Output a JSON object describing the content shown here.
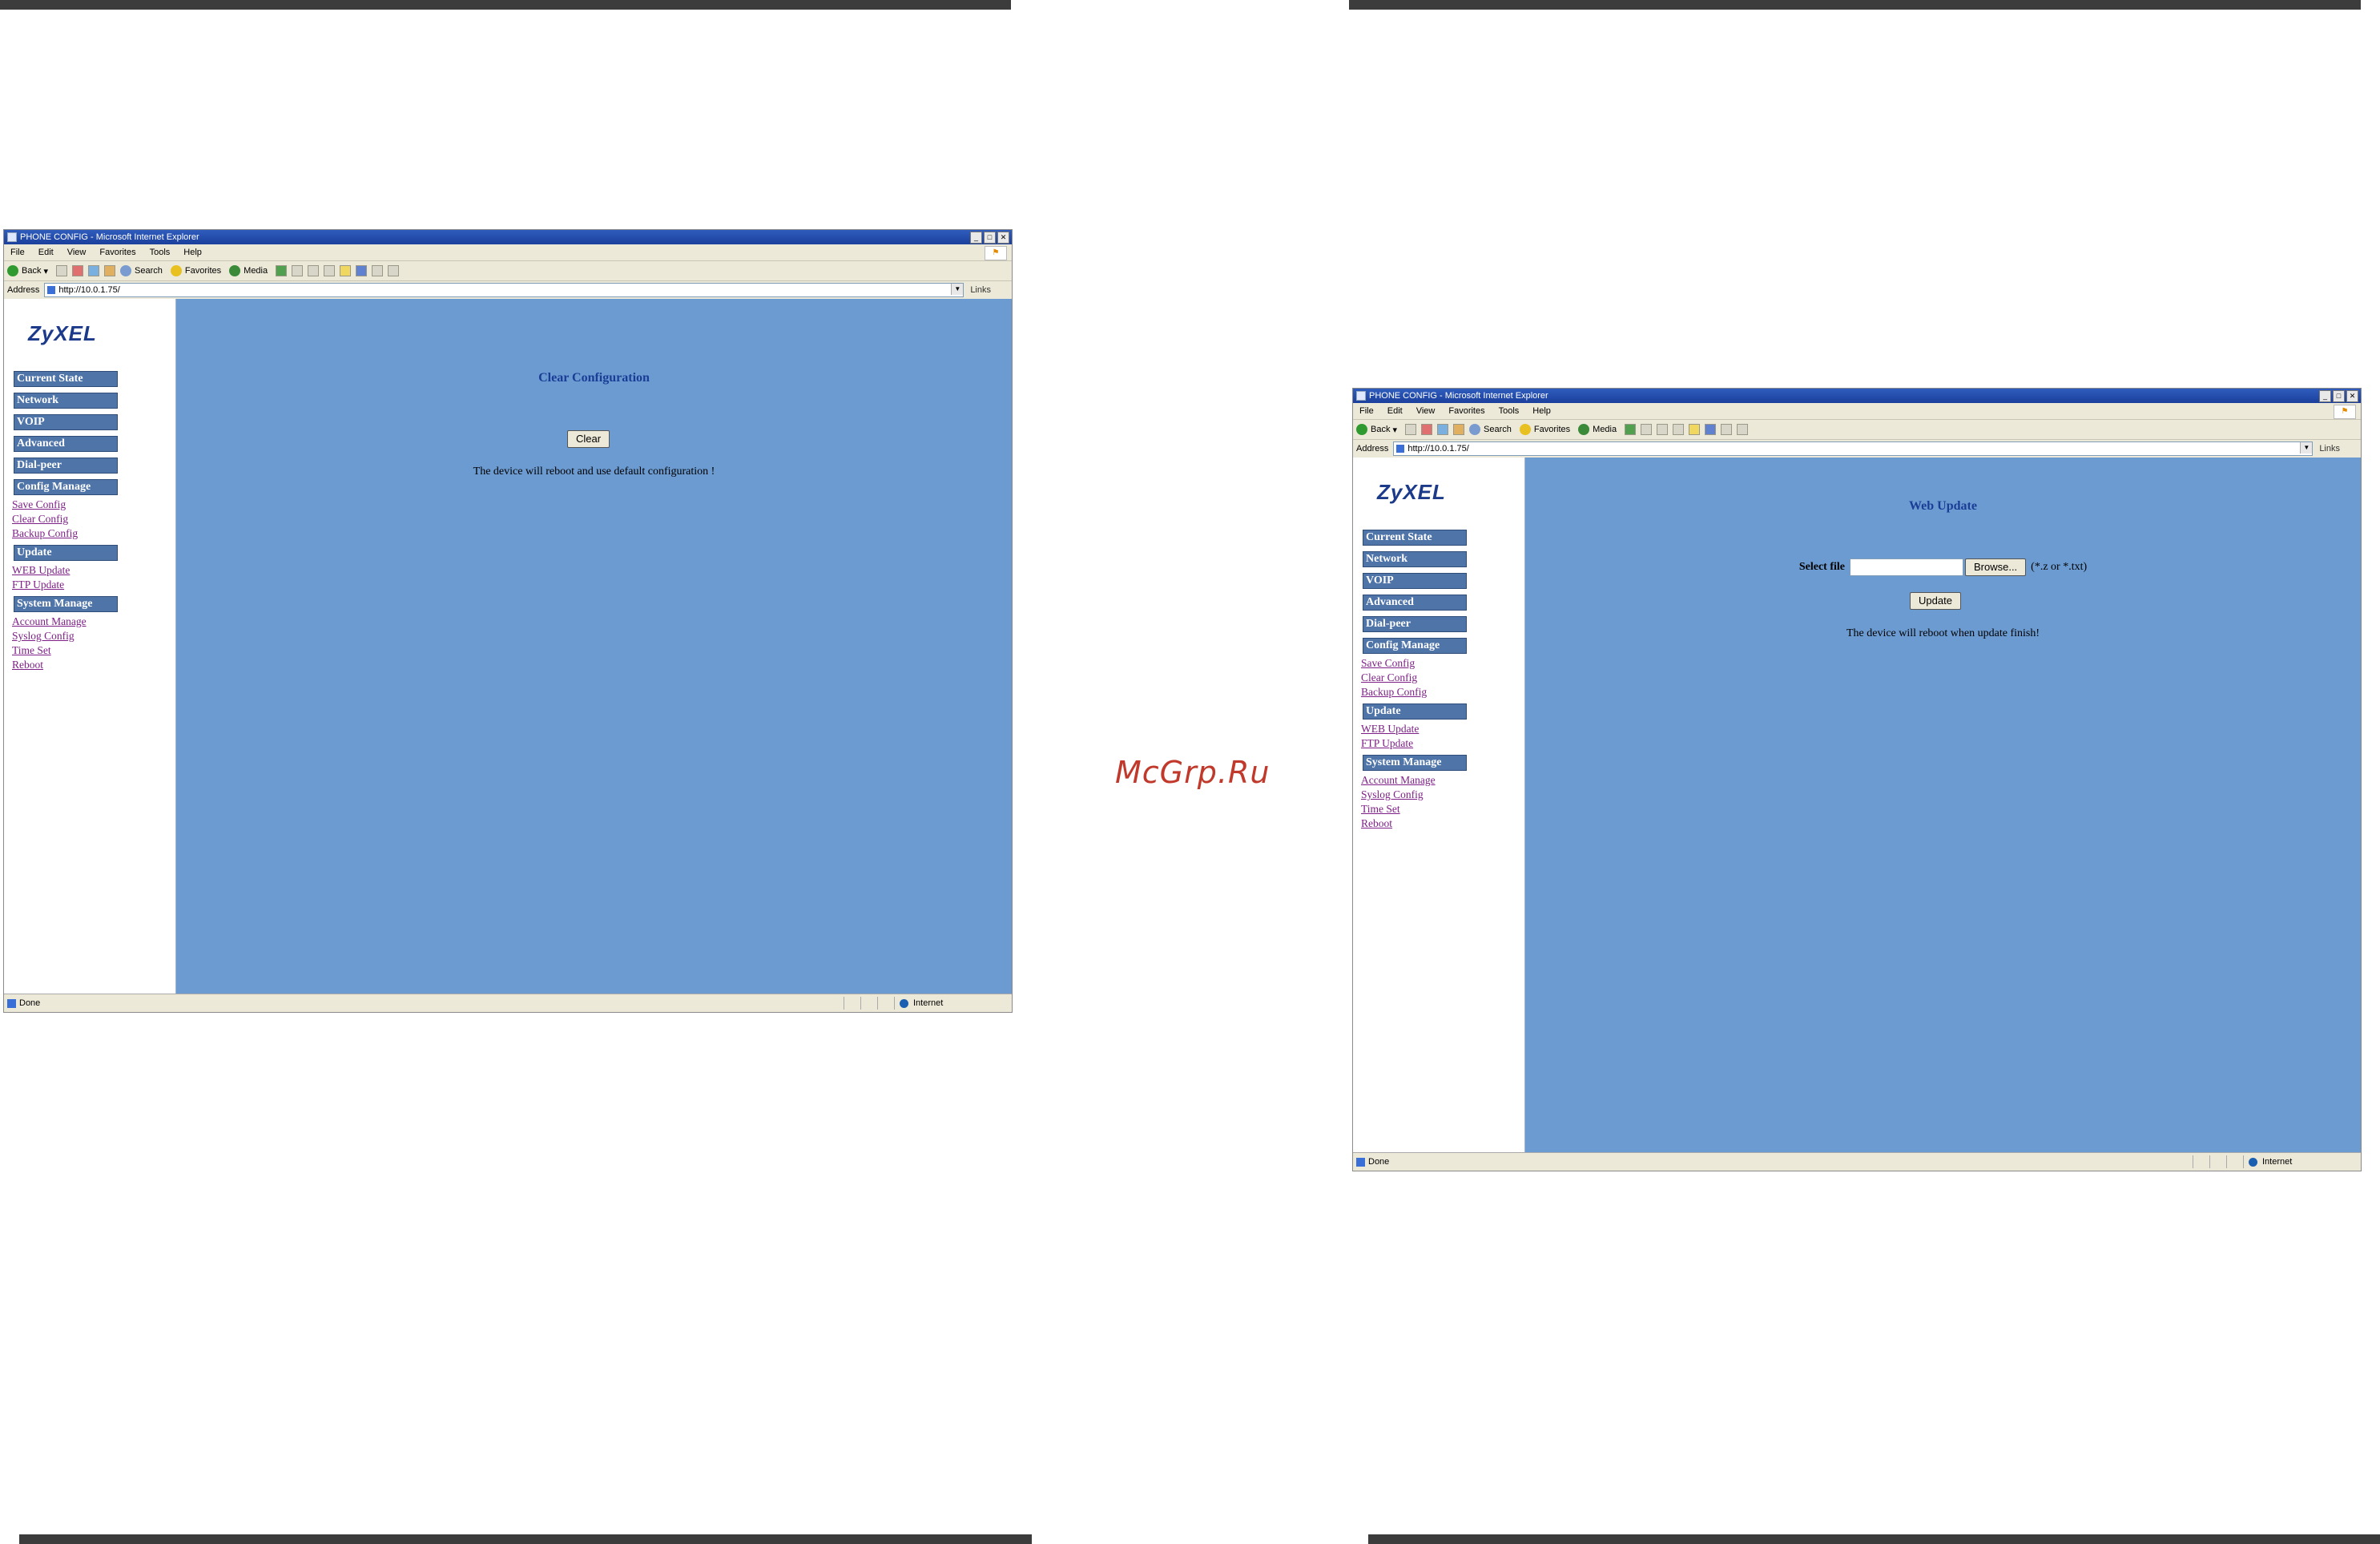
{
  "watermark": "McGrp.Ru",
  "windows": [
    {
      "title": "PHONE CONFIG - Microsoft Internet Explorer",
      "menu": [
        "File",
        "Edit",
        "View",
        "Favorites",
        "Tools",
        "Help"
      ],
      "toolbar": {
        "back": "Back",
        "search": "Search",
        "favorites": "Favorites",
        "media": "Media"
      },
      "address_label": "Address",
      "address_url": "http://10.0.1.75/",
      "links_label": "Links",
      "status_text": "Done",
      "status_zone": "Internet",
      "logo": "ZyXEL",
      "main_title": "Clear Configuration",
      "button": "Clear",
      "message": "The device will reboot and use default configuration !"
    },
    {
      "title": "PHONE CONFIG - Microsoft Internet Explorer",
      "menu": [
        "File",
        "Edit",
        "View",
        "Favorites",
        "Tools",
        "Help"
      ],
      "toolbar": {
        "back": "Back",
        "search": "Search",
        "favorites": "Favorites",
        "media": "Media"
      },
      "address_label": "Address",
      "address_url": "http://10.0.1.75/",
      "links_label": "Links",
      "status_text": "Done",
      "status_zone": "Internet",
      "logo": "ZyXEL",
      "main_title": "Web Update",
      "select_label": "Select file",
      "browse_button": "Browse...",
      "file_hint": "(*.z or *.txt)",
      "button": "Update",
      "message": "The device will reboot when update finish!"
    }
  ],
  "sidebar": {
    "sections": {
      "current_state": "Current State",
      "network": "Network",
      "voip": "VOIP",
      "advanced": "Advanced",
      "dial_peer": "Dial-peer",
      "config_manage": "Config Manage",
      "update": "Update",
      "system_manage": "System Manage"
    },
    "links": {
      "save_config": "Save Config",
      "clear_config": "Clear Config",
      "backup_config": "Backup Config",
      "web_update": "WEB Update",
      "ftp_update": "FTP Update",
      "account_manage": "Account Manage",
      "syslog_config": "Syslog Config",
      "time_set": "Time Set",
      "reboot": "Reboot"
    }
  }
}
